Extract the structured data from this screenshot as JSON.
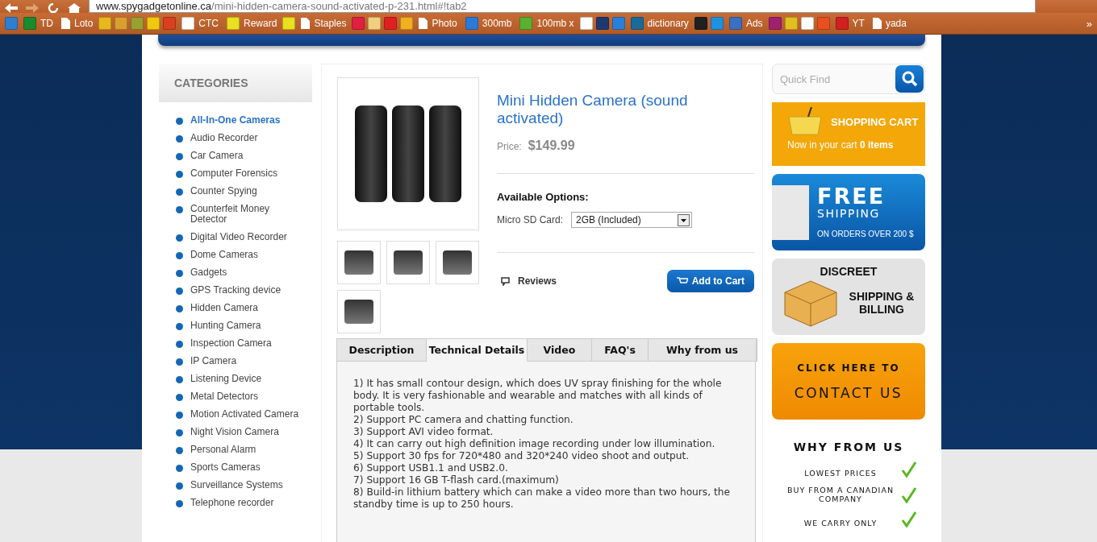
{
  "browser": {
    "url_domain": "www.spygadgetonline.ca",
    "url_path": "/mini-hidden-camera-sound-activated-p-231.html#!tab2"
  },
  "bookmarks": [
    {
      "kind": "logo",
      "color": "#2f7fd0"
    },
    {
      "kind": "logo",
      "color": "#1a8a2e",
      "label": "TD"
    },
    {
      "kind": "page",
      "label": "Loto"
    },
    {
      "kind": "logo",
      "color": "#e8b820"
    },
    {
      "kind": "logo",
      "color": "#d8a030"
    },
    {
      "kind": "logo",
      "color": "#9aa030"
    },
    {
      "kind": "logo",
      "color": "#f0c810"
    },
    {
      "kind": "logo",
      "color": "#d84020"
    },
    {
      "kind": "logo",
      "color": "#ffffff",
      "label": "CTC"
    },
    {
      "kind": "logo",
      "color": "#e8e020",
      "label": "Reward"
    },
    {
      "kind": "logo",
      "color": "#e8e020"
    },
    {
      "kind": "page",
      "label": "Staples"
    },
    {
      "kind": "logo",
      "color": "#e02040"
    },
    {
      "kind": "logo",
      "color": "#f0d080"
    },
    {
      "kind": "logo",
      "color": "#e02020"
    },
    {
      "kind": "logo",
      "color": "#f0b020"
    },
    {
      "kind": "page",
      "label": "Photo"
    },
    {
      "kind": "logo",
      "color": "#2a7ad8",
      "label": "300mb"
    },
    {
      "kind": "logo",
      "color": "#5ab030",
      "label": "100mb x"
    },
    {
      "kind": "logo",
      "color": "#ffffff"
    },
    {
      "kind": "logo",
      "color": "#203870"
    },
    {
      "kind": "logo",
      "color": "#2a80d8"
    },
    {
      "kind": "logo",
      "color": "#1a6a9a",
      "label": "dictionary"
    },
    {
      "kind": "logo",
      "color": "#202020"
    },
    {
      "kind": "logo",
      "color": "#2090e0"
    },
    {
      "kind": "logo",
      "color": "#3a70c0",
      "label": "Ads"
    },
    {
      "kind": "logo",
      "color": "#a02070"
    },
    {
      "kind": "logo",
      "color": "#e0c020"
    },
    {
      "kind": "logo",
      "color": "#ffffff"
    },
    {
      "kind": "logo",
      "color": "#e85020"
    },
    {
      "kind": "logo",
      "color": "#d02020",
      "label": "YT"
    },
    {
      "kind": "page",
      "label": "yada"
    }
  ],
  "bookmarks_more": "»",
  "sidebar": {
    "title": "CATEGORIES",
    "items": [
      {
        "label": "All-In-One Cameras",
        "selected": true
      },
      {
        "label": "Audio Recorder",
        "selected": false
      },
      {
        "label": "Car Camera",
        "selected": false
      },
      {
        "label": "Computer Forensics",
        "selected": false
      },
      {
        "label": "Counter Spying",
        "selected": false
      },
      {
        "label": "Counterfeit Money Detector",
        "selected": false
      },
      {
        "label": "Digital Video Recorder",
        "selected": false
      },
      {
        "label": "Dome Cameras",
        "selected": false
      },
      {
        "label": "Gadgets",
        "selected": false
      },
      {
        "label": "GPS Tracking device",
        "selected": false
      },
      {
        "label": "Hidden Camera",
        "selected": false
      },
      {
        "label": "Hunting Camera",
        "selected": false
      },
      {
        "label": "Inspection Camera",
        "selected": false
      },
      {
        "label": "IP Camera",
        "selected": false
      },
      {
        "label": "Listening Device",
        "selected": false
      },
      {
        "label": "Metal Detectors",
        "selected": false
      },
      {
        "label": "Motion Activated Camera",
        "selected": false
      },
      {
        "label": "Night Vision Camera",
        "selected": false
      },
      {
        "label": "Personal Alarm",
        "selected": false
      },
      {
        "label": "Sports Cameras",
        "selected": false
      },
      {
        "label": "Surveillance Systems",
        "selected": false
      },
      {
        "label": "Telephone recorder",
        "selected": false
      }
    ]
  },
  "product": {
    "title": "Mini Hidden Camera (sound activated)",
    "price_label": "Price:",
    "price": "$149.99",
    "options_title": "Available Options:",
    "option_label": "Micro SD Card:",
    "option_value": "2GB (Included)",
    "reviews": "Reviews",
    "add_to_cart": "Add to Cart"
  },
  "tabs": [
    {
      "label": "Description",
      "selected": false
    },
    {
      "label": "Technical Details",
      "selected": true
    },
    {
      "label": "Video",
      "selected": false
    },
    {
      "label": "FAQ's",
      "selected": false
    },
    {
      "label": "Why from us",
      "selected": false
    }
  ],
  "details": [
    "1) It has small contour design, which does UV spray finishing for the whole body. It is very fashionable and wearable and matches with all kinds of portable tools.",
    "2) Support PC camera and chatting function.",
    "3) Support AVI video format.",
    "4) It can carry out high definition image recording under low illumination.",
    "5) Support 30 fps for 720*480 and 320*240 video shoot and output.",
    "6) Support USB1.1 and USB2.0.",
    "7) Support 16 GB T-flash card.(maximum)",
    "8) Build-in lithium battery which can make a video more than two hours, the standby time is up to 250 hours."
  ],
  "search": {
    "placeholder": "Quick Find"
  },
  "cart": {
    "title": "SHOPPING CART",
    "status": "Now in your cart **0 items**"
  },
  "free_shipping": {
    "title": "FREE",
    "subtitle": "SHIPPING",
    "note": "ON ORDERS OVER 200 $"
  },
  "discreet": {
    "title": "DISCREET",
    "subtitle": "SHIPPING & BILLING"
  },
  "contact": {
    "line_1": "CLICK HERE TO",
    "line_2": "CONTACT US"
  },
  "why": {
    "title": "WHY FROM US",
    "items": [
      "LOWEST PRICES",
      "BUY FROM A CANADIAN COMPANY",
      "WE CARRY ONLY"
    ]
  }
}
